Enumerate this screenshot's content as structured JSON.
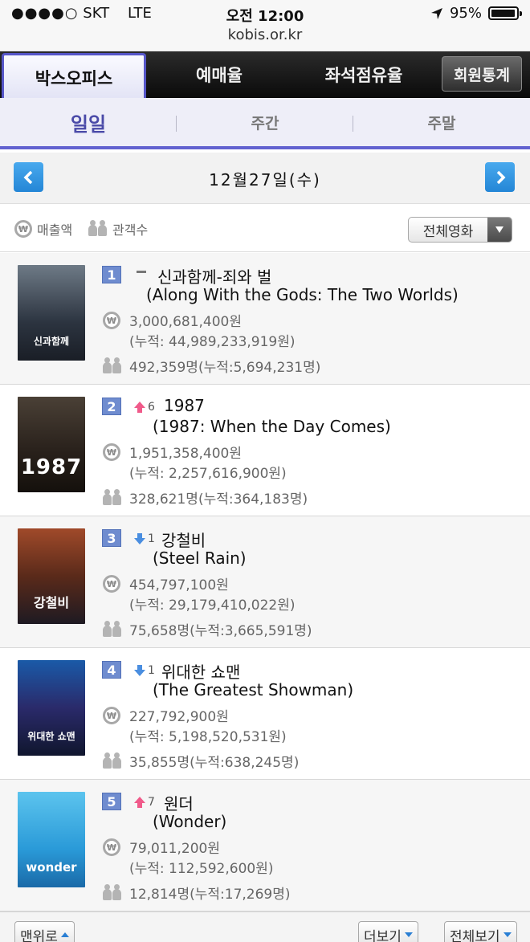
{
  "status_bar": {
    "carrier": "SKT",
    "network": "LTE",
    "time": "오전 12:00",
    "battery": "95%",
    "battery_level": 0.95,
    "url": "kobis.or.kr"
  },
  "main_tabs": [
    "박스오피스",
    "예매율",
    "좌석점유율",
    "회원통계"
  ],
  "sub_tabs": [
    "일일",
    "주간",
    "주말"
  ],
  "date_label": "12월27일(수)",
  "legend": {
    "sales": "매출액",
    "audience": "관객수"
  },
  "filter": {
    "label": "전체영화"
  },
  "movies": [
    {
      "rank": "1",
      "change": "",
      "title_ko": "신과함께-죄와 벌",
      "title_en": "(Along With the Gods: The Two Worlds)",
      "sales": "3,000,681,400원",
      "sales_acc": "(누적: 44,989,233,919원)",
      "audience": "492,359명(누적:5,694,231명)",
      "poster_text": "신과함께"
    },
    {
      "rank": "2",
      "change": "6",
      "title_ko": "1987",
      "title_en": "(1987: When the Day Comes)",
      "sales": "1,951,358,400원",
      "sales_acc": "(누적: 2,257,616,900원)",
      "audience": "328,621명(누적:364,183명)",
      "poster_text": "1987"
    },
    {
      "rank": "3",
      "change": "1",
      "title_ko": "강철비",
      "title_en": "(Steel Rain)",
      "sales": "454,797,100원",
      "sales_acc": "(누적: 29,179,410,022원)",
      "audience": "75,658명(누적:3,665,591명)",
      "poster_text": "강철비"
    },
    {
      "rank": "4",
      "change": "1",
      "title_ko": "위대한 쇼맨",
      "title_en": "(The Greatest Showman)",
      "sales": "227,792,900원",
      "sales_acc": "(누적: 5,198,520,531원)",
      "audience": "35,855명(누적:638,245명)",
      "poster_text": "위대한 쇼맨"
    },
    {
      "rank": "5",
      "change": "7",
      "title_ko": "원더",
      "title_en": "(Wonder)",
      "sales": "79,011,200원",
      "sales_acc": "(누적: 112,592,600원)",
      "audience": "12,814명(누적:17,269명)",
      "poster_text": "wonder"
    }
  ],
  "bottom_buttons": {
    "top": "맨위로",
    "more": "더보기",
    "all": "전체보기"
  }
}
